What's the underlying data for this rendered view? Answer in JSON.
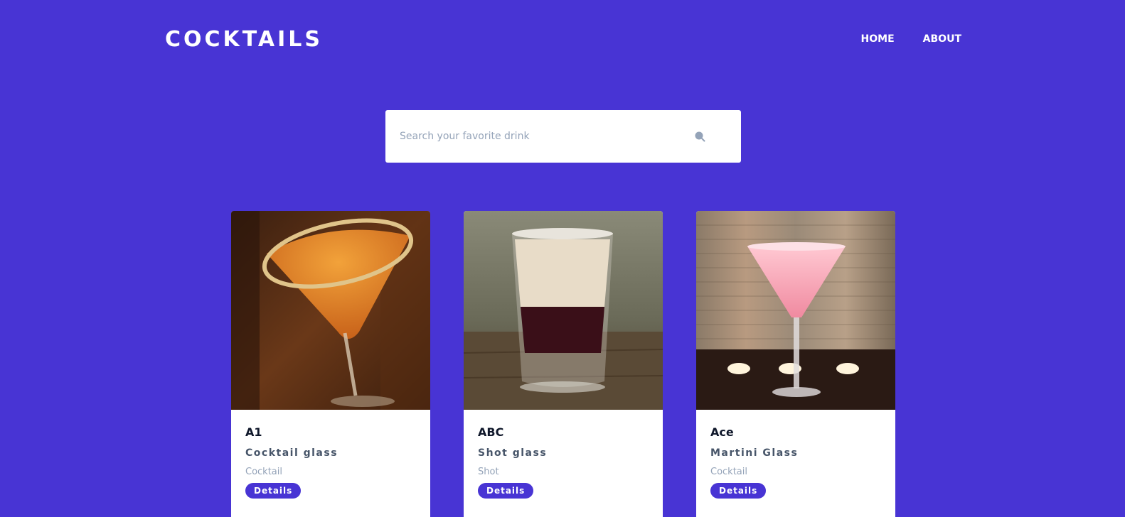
{
  "brand": {
    "logo": "COCKTAILS"
  },
  "nav": {
    "links": [
      "HOME",
      "ABOUT"
    ]
  },
  "search": {
    "placeholder": "Search your favorite drink",
    "value": ""
  },
  "colors": {
    "background": "#4834d4",
    "accent": "#4834d4",
    "card": "#ffffff"
  },
  "cocktails": [
    {
      "name": "A1",
      "glass": "Cocktail glass",
      "category": "Cocktail",
      "button": "Details"
    },
    {
      "name": "ABC",
      "glass": "Shot glass",
      "category": "Shot",
      "button": "Details"
    },
    {
      "name": "Ace",
      "glass": "Martini Glass",
      "category": "Cocktail",
      "button": "Details"
    }
  ]
}
